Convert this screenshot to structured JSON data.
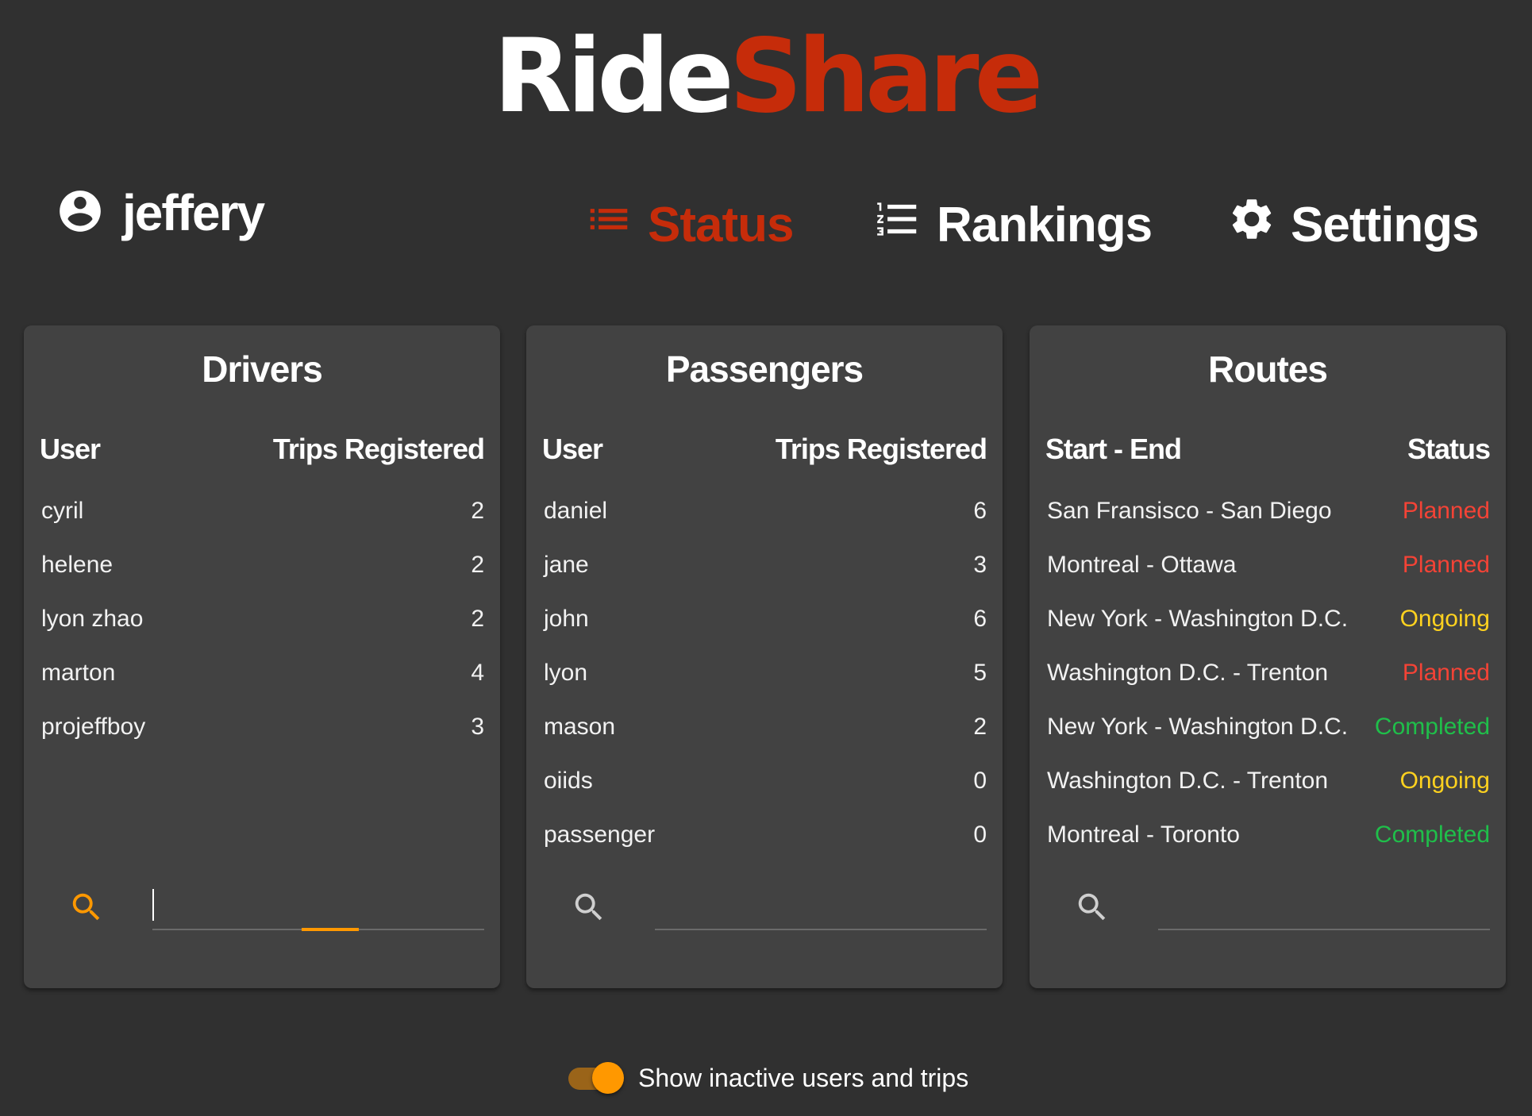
{
  "logo": {
    "part1": "Ride",
    "part2": "Share"
  },
  "user": {
    "name": "jeffery",
    "icon": "account-circle-icon"
  },
  "nav": {
    "status": {
      "label": "Status",
      "icon": "list-icon",
      "active": true
    },
    "rankings": {
      "label": "Rankings",
      "icon": "format-list-numbered-icon"
    },
    "settings": {
      "label": "Settings",
      "icon": "gear-icon"
    }
  },
  "colors": {
    "accent": "#c62c0a",
    "orange": "#ff9800",
    "planned": "#f44336",
    "ongoing": "#ffd21f",
    "completed": "#1fbf4a"
  },
  "drivers": {
    "title": "Drivers",
    "columns": [
      "User",
      "Trips Registered"
    ],
    "rows": [
      {
        "user": "cyril",
        "trips": "2"
      },
      {
        "user": "helene",
        "trips": "2"
      },
      {
        "user": "lyon zhao",
        "trips": "2"
      },
      {
        "user": "marton",
        "trips": "4"
      },
      {
        "user": "projeffboy",
        "trips": "3"
      }
    ],
    "search_value": ""
  },
  "passengers": {
    "title": "Passengers",
    "columns": [
      "User",
      "Trips Registered"
    ],
    "rows": [
      {
        "user": "daniel",
        "trips": "6"
      },
      {
        "user": "jane",
        "trips": "3"
      },
      {
        "user": "john",
        "trips": "6"
      },
      {
        "user": "lyon",
        "trips": "5"
      },
      {
        "user": "mason",
        "trips": "2"
      },
      {
        "user": "oiids",
        "trips": "0"
      },
      {
        "user": "passenger",
        "trips": "0"
      }
    ],
    "search_value": ""
  },
  "routes": {
    "title": "Routes",
    "columns": [
      "Start - End",
      "Status"
    ],
    "rows": [
      {
        "route": "San Fransisco - San Diego",
        "status": "Planned"
      },
      {
        "route": "Montreal - Ottawa",
        "status": "Planned"
      },
      {
        "route": "New York - Washington D.C.",
        "status": "Ongoing"
      },
      {
        "route": "Washington D.C. - Trenton",
        "status": "Planned"
      },
      {
        "route": "New York - Washington D.C.",
        "status": "Completed"
      },
      {
        "route": "Washington D.C. - Trenton",
        "status": "Ongoing"
      },
      {
        "route": "Montreal - Toronto",
        "status": "Completed"
      }
    ],
    "search_value": ""
  },
  "toggle": {
    "label": "Show inactive users and trips",
    "checked": true
  }
}
